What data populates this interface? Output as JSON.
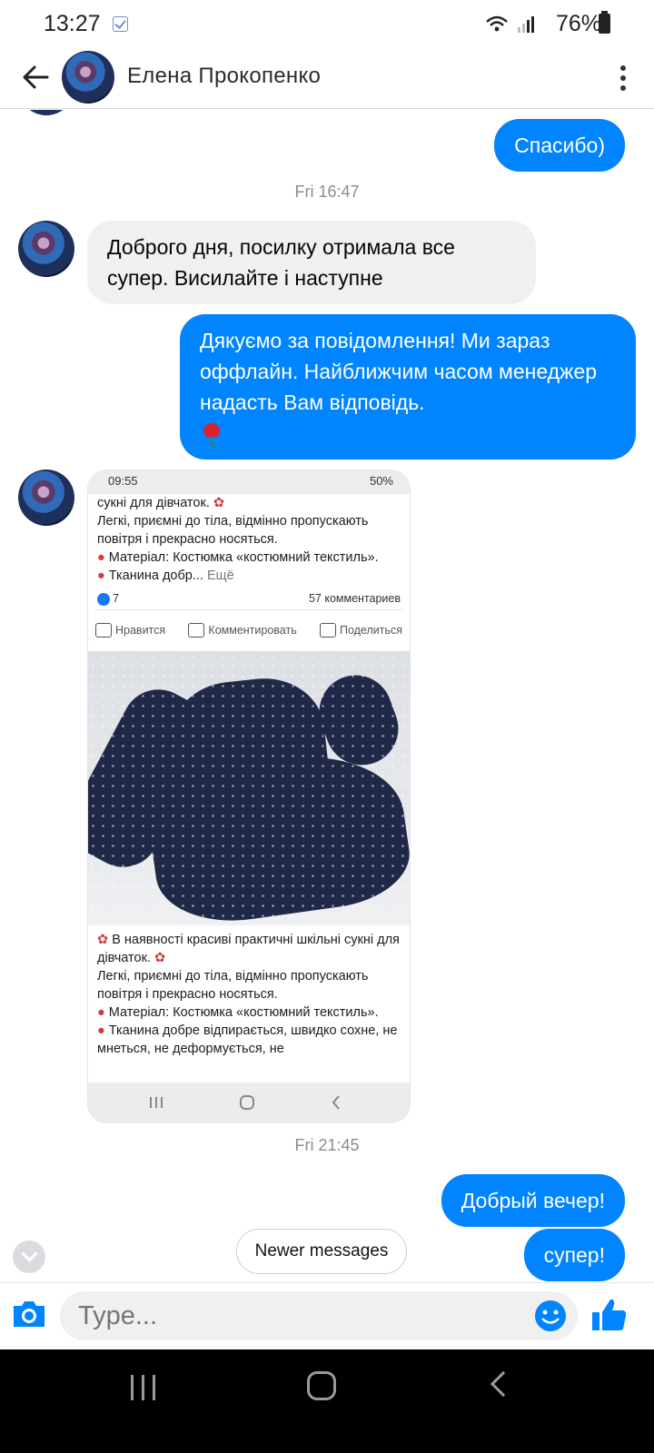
{
  "status_bar": {
    "time": "13:27",
    "battery": "76%"
  },
  "header": {
    "contact_name": "Елена Прокопенко"
  },
  "messages": {
    "m1": "Спасибо)",
    "ts1": "Fri 16:47",
    "m2": "Доброго дня, посилку отримала все супер. Висилайте і наступне",
    "m3": "Дякуємо за повідомлення! Ми зараз оффлайн. Найближчим часом менеджер надасть Вам відповідь.",
    "ts2": "Fri 21:45",
    "m4": "Добрый вечер!",
    "m5": "супер!"
  },
  "shared_screenshot": {
    "time": "09:55",
    "battery": "50%",
    "post_top_1": "сукні для дівчаток.",
    "post_top_2": "Легкі, приємні до тіла, відмінно пропускають повітря і прекрасно носяться.",
    "post_top_3": "Матеріал: Костюмка «костюмний текстиль».",
    "post_top_4": "Тканина добр...",
    "more": "Ещё",
    "likes": "7",
    "comments_count": "57 комментариев",
    "action_like": "Нравится",
    "action_comment": "Комментировать",
    "action_share": "Поделиться",
    "post_bottom_1": "В наявності красиві практичні шкільні сукні для дівчаток.",
    "post_bottom_2": "Легкі, приємні до тіла, відмінно пропускають повітря і прекрасно носяться.",
    "post_bottom_3": "Матеріал: Костюмка «костюмний текстиль».",
    "post_bottom_4": "Тканина добре відпирається, швидко сохне, не мнеться, не деформується, не"
  },
  "newer_messages": "Newer messages",
  "composer": {
    "placeholder": "Type..."
  },
  "colors": {
    "accent": "#0084ff",
    "incoming_bubble": "#f0f0f0"
  }
}
